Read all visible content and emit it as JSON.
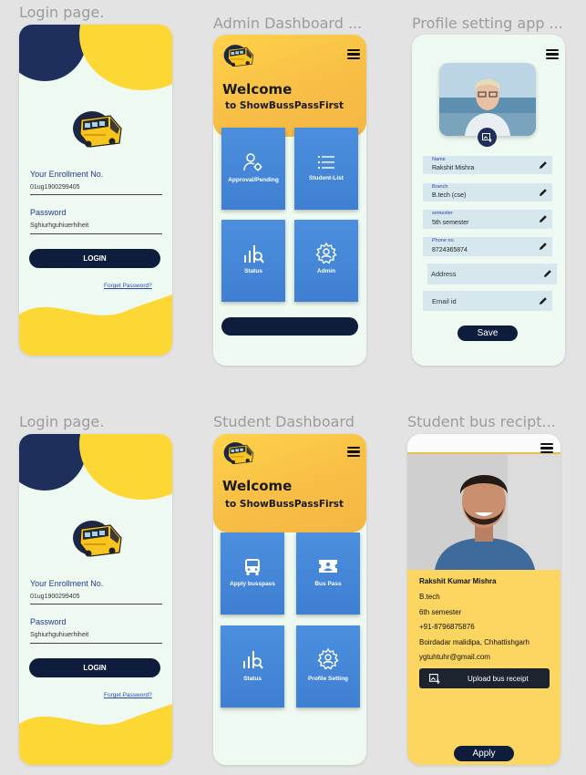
{
  "frames": {
    "login1_title": "Login page.",
    "admin_title": "Admin Dashboard ...",
    "profile_title": "Profile setting app ...",
    "login2_title": "Login page.",
    "student_title": "Student Dashboard",
    "receipt_title": "Student bus recipt..."
  },
  "login": {
    "enrollment_label": "Your Enrollment No.",
    "enrollment_value": "01ug1900299405",
    "password_label": "Password",
    "password_value": "Sghiurhguhiuerhiheit",
    "login_button": "LOGIN",
    "forgot_link": "Forget Password?"
  },
  "admin": {
    "welcome": "Welcome",
    "subtitle": "to ShowBussPassFirst",
    "tiles": [
      "Approval/Pending",
      "Student-List",
      "Status",
      "Admin"
    ]
  },
  "student": {
    "welcome": "Welcome",
    "subtitle": "to ShowBussPassFirst",
    "tiles": [
      "Apply busspass",
      "Bus Pass",
      "Status",
      "Profile Setting"
    ]
  },
  "profile": {
    "fields": [
      {
        "label": "Name",
        "value": "Rakshit Mishra"
      },
      {
        "label": "Branch",
        "value": "B.tech (cse)"
      },
      {
        "label": "semester",
        "value": "5th semester"
      },
      {
        "label": "Phone no.",
        "value": "8724365874"
      }
    ],
    "address_placeholder": "Address",
    "email_placeholder": "Email id",
    "save_button": "Save"
  },
  "receipt": {
    "name": "Rakshit Kumar Mishra",
    "branch": "B.tech",
    "semester": "6th semester",
    "phone": "+91-8796875876",
    "address": "Boirdadar malidipa, Chhattishgarh",
    "email": "ygtuhtuhr@gmail.com",
    "upload_button": "Upload bus receipt",
    "apply_button": "Apply"
  },
  "colors": {
    "yellow": "#fdd835",
    "navy": "#1e2f5c",
    "tile_blue": "#4586d8",
    "button_dark": "#0f1d3c",
    "mint_bg": "#eefaf1"
  }
}
